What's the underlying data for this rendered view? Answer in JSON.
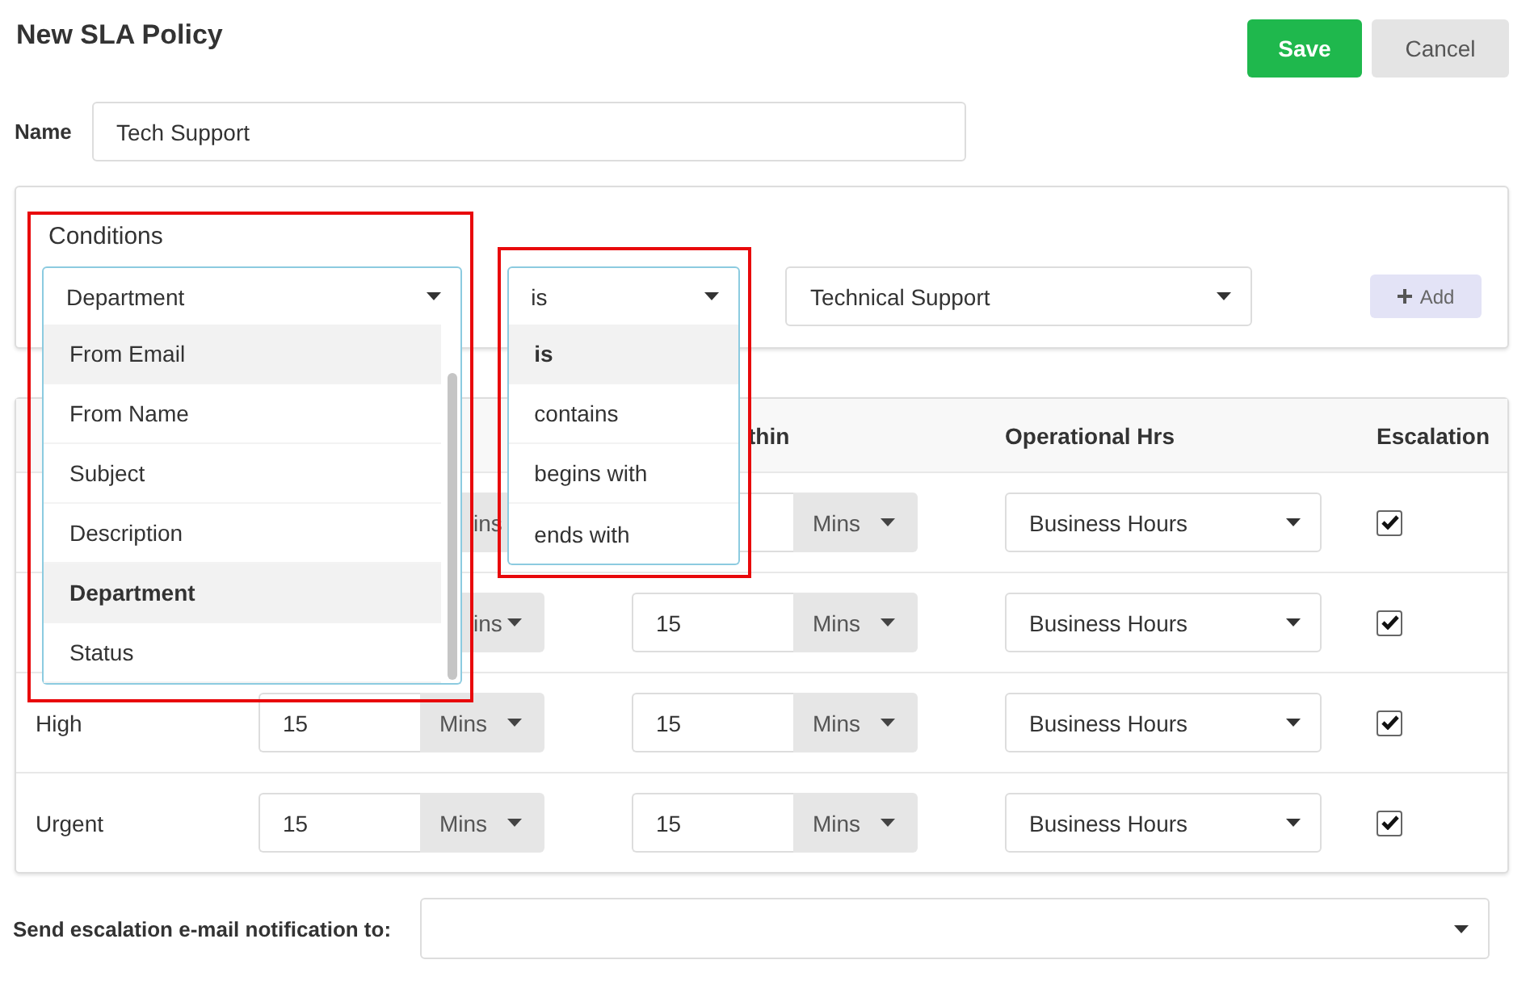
{
  "title": "New SLA Policy",
  "buttons": [
    {
      "label": "Save",
      "kind": "primary"
    },
    {
      "label": "Cancel",
      "kind": "secondary"
    }
  ],
  "name": {
    "label": "Name",
    "value": "Tech Support"
  },
  "conditions": {
    "heading": "Conditions",
    "field": {
      "value": "Department",
      "expanded": true,
      "framed": true,
      "options": [
        {
          "label": "From Email",
          "selected": false,
          "highlighted": true
        },
        {
          "label": "From Name",
          "selected": false,
          "highlighted": false
        },
        {
          "label": "Subject",
          "selected": false,
          "highlighted": false
        },
        {
          "label": "Description",
          "selected": false,
          "highlighted": false
        },
        {
          "label": "Department",
          "selected": true,
          "highlighted": false
        },
        {
          "label": "Status",
          "selected": false,
          "highlighted": false
        }
      ]
    },
    "operator": {
      "value": "is",
      "expanded": true,
      "framed": true,
      "options": [
        {
          "label": "is",
          "selected": true,
          "highlighted": false
        },
        {
          "label": "contains",
          "selected": false,
          "highlighted": false
        },
        {
          "label": "begins with",
          "selected": false,
          "highlighted": false
        },
        {
          "label": "ends with",
          "selected": false,
          "highlighted": false
        }
      ]
    },
    "value": {
      "value": "Technical Support",
      "expanded": false
    },
    "add_button": "Add"
  },
  "table": {
    "header": {
      "column_3": "thin",
      "operational_hrs": "Operational Hrs",
      "escalation": "Escalation"
    },
    "rows": [
      {
        "response": {
          "unit": "ins"
        },
        "resolve": {
          "unit": "Mins",
          "input_shown": true
        },
        "hours": "Business Hours",
        "escalation": {
          "checked": true
        }
      },
      {
        "response": {
          "unit": "ins"
        },
        "resolve": {
          "value": "15",
          "unit": "Mins"
        },
        "hours": "Business Hours",
        "escalation": {
          "checked": true
        }
      },
      {
        "priority": "High",
        "response": {
          "value": "15",
          "unit": "Mins"
        },
        "resolve": {
          "value": "15",
          "unit": "Mins"
        },
        "hours": "Business Hours",
        "escalation": {
          "checked": true
        }
      },
      {
        "priority": "Urgent",
        "response": {
          "value": "15",
          "unit": "Mins"
        },
        "resolve": {
          "value": "15",
          "unit": "Mins"
        },
        "hours": "Business Hours",
        "escalation": {
          "checked": true
        }
      }
    ]
  },
  "footer": {
    "label": "Send escalation e-mail notification to:"
  }
}
